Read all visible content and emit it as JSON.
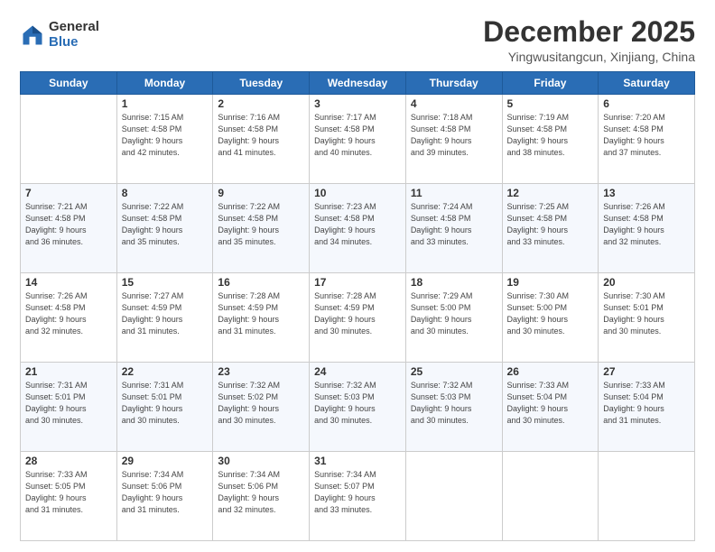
{
  "logo": {
    "general": "General",
    "blue": "Blue"
  },
  "header": {
    "month": "December 2025",
    "location": "Yingwusitangcun, Xinjiang, China"
  },
  "weekdays": [
    "Sunday",
    "Monday",
    "Tuesday",
    "Wednesday",
    "Thursday",
    "Friday",
    "Saturday"
  ],
  "weeks": [
    [
      {
        "day": "",
        "info": ""
      },
      {
        "day": "1",
        "info": "Sunrise: 7:15 AM\nSunset: 4:58 PM\nDaylight: 9 hours\nand 42 minutes."
      },
      {
        "day": "2",
        "info": "Sunrise: 7:16 AM\nSunset: 4:58 PM\nDaylight: 9 hours\nand 41 minutes."
      },
      {
        "day": "3",
        "info": "Sunrise: 7:17 AM\nSunset: 4:58 PM\nDaylight: 9 hours\nand 40 minutes."
      },
      {
        "day": "4",
        "info": "Sunrise: 7:18 AM\nSunset: 4:58 PM\nDaylight: 9 hours\nand 39 minutes."
      },
      {
        "day": "5",
        "info": "Sunrise: 7:19 AM\nSunset: 4:58 PM\nDaylight: 9 hours\nand 38 minutes."
      },
      {
        "day": "6",
        "info": "Sunrise: 7:20 AM\nSunset: 4:58 PM\nDaylight: 9 hours\nand 37 minutes."
      }
    ],
    [
      {
        "day": "7",
        "info": "Sunrise: 7:21 AM\nSunset: 4:58 PM\nDaylight: 9 hours\nand 36 minutes."
      },
      {
        "day": "8",
        "info": "Sunrise: 7:22 AM\nSunset: 4:58 PM\nDaylight: 9 hours\nand 35 minutes."
      },
      {
        "day": "9",
        "info": "Sunrise: 7:22 AM\nSunset: 4:58 PM\nDaylight: 9 hours\nand 35 minutes."
      },
      {
        "day": "10",
        "info": "Sunrise: 7:23 AM\nSunset: 4:58 PM\nDaylight: 9 hours\nand 34 minutes."
      },
      {
        "day": "11",
        "info": "Sunrise: 7:24 AM\nSunset: 4:58 PM\nDaylight: 9 hours\nand 33 minutes."
      },
      {
        "day": "12",
        "info": "Sunrise: 7:25 AM\nSunset: 4:58 PM\nDaylight: 9 hours\nand 33 minutes."
      },
      {
        "day": "13",
        "info": "Sunrise: 7:26 AM\nSunset: 4:58 PM\nDaylight: 9 hours\nand 32 minutes."
      }
    ],
    [
      {
        "day": "14",
        "info": "Sunrise: 7:26 AM\nSunset: 4:58 PM\nDaylight: 9 hours\nand 32 minutes."
      },
      {
        "day": "15",
        "info": "Sunrise: 7:27 AM\nSunset: 4:59 PM\nDaylight: 9 hours\nand 31 minutes."
      },
      {
        "day": "16",
        "info": "Sunrise: 7:28 AM\nSunset: 4:59 PM\nDaylight: 9 hours\nand 31 minutes."
      },
      {
        "day": "17",
        "info": "Sunrise: 7:28 AM\nSunset: 4:59 PM\nDaylight: 9 hours\nand 30 minutes."
      },
      {
        "day": "18",
        "info": "Sunrise: 7:29 AM\nSunset: 5:00 PM\nDaylight: 9 hours\nand 30 minutes."
      },
      {
        "day": "19",
        "info": "Sunrise: 7:30 AM\nSunset: 5:00 PM\nDaylight: 9 hours\nand 30 minutes."
      },
      {
        "day": "20",
        "info": "Sunrise: 7:30 AM\nSunset: 5:01 PM\nDaylight: 9 hours\nand 30 minutes."
      }
    ],
    [
      {
        "day": "21",
        "info": "Sunrise: 7:31 AM\nSunset: 5:01 PM\nDaylight: 9 hours\nand 30 minutes."
      },
      {
        "day": "22",
        "info": "Sunrise: 7:31 AM\nSunset: 5:01 PM\nDaylight: 9 hours\nand 30 minutes."
      },
      {
        "day": "23",
        "info": "Sunrise: 7:32 AM\nSunset: 5:02 PM\nDaylight: 9 hours\nand 30 minutes."
      },
      {
        "day": "24",
        "info": "Sunrise: 7:32 AM\nSunset: 5:03 PM\nDaylight: 9 hours\nand 30 minutes."
      },
      {
        "day": "25",
        "info": "Sunrise: 7:32 AM\nSunset: 5:03 PM\nDaylight: 9 hours\nand 30 minutes."
      },
      {
        "day": "26",
        "info": "Sunrise: 7:33 AM\nSunset: 5:04 PM\nDaylight: 9 hours\nand 30 minutes."
      },
      {
        "day": "27",
        "info": "Sunrise: 7:33 AM\nSunset: 5:04 PM\nDaylight: 9 hours\nand 31 minutes."
      }
    ],
    [
      {
        "day": "28",
        "info": "Sunrise: 7:33 AM\nSunset: 5:05 PM\nDaylight: 9 hours\nand 31 minutes."
      },
      {
        "day": "29",
        "info": "Sunrise: 7:34 AM\nSunset: 5:06 PM\nDaylight: 9 hours\nand 31 minutes."
      },
      {
        "day": "30",
        "info": "Sunrise: 7:34 AM\nSunset: 5:06 PM\nDaylight: 9 hours\nand 32 minutes."
      },
      {
        "day": "31",
        "info": "Sunrise: 7:34 AM\nSunset: 5:07 PM\nDaylight: 9 hours\nand 33 minutes."
      },
      {
        "day": "",
        "info": ""
      },
      {
        "day": "",
        "info": ""
      },
      {
        "day": "",
        "info": ""
      }
    ]
  ]
}
